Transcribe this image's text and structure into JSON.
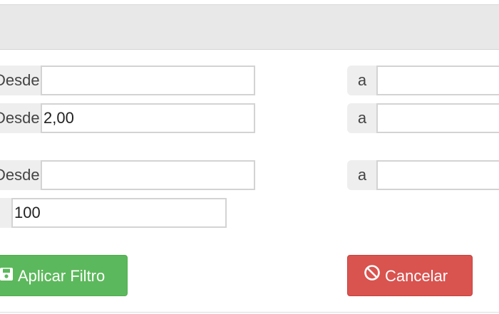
{
  "filters": {
    "row1": {
      "from_label": "Desde",
      "from_value": "",
      "to_label": "a",
      "to_value": ""
    },
    "row2": {
      "from_label": "Desde",
      "from_value": "2,00",
      "to_label": "a",
      "to_value": ""
    },
    "row3": {
      "from_label": "Desde",
      "from_value": "",
      "to_label": "a",
      "to_value": ""
    },
    "row4": {
      "value": "100"
    }
  },
  "actions": {
    "apply_label": "Aplicar Filtro",
    "apply_icon": "save-icon",
    "cancel_label": "Cancelar",
    "cancel_icon": "ban-icon"
  },
  "colors": {
    "apply_bg": "#5cb85c",
    "cancel_bg": "#d9534f",
    "header_bg": "#e8e8e8"
  }
}
